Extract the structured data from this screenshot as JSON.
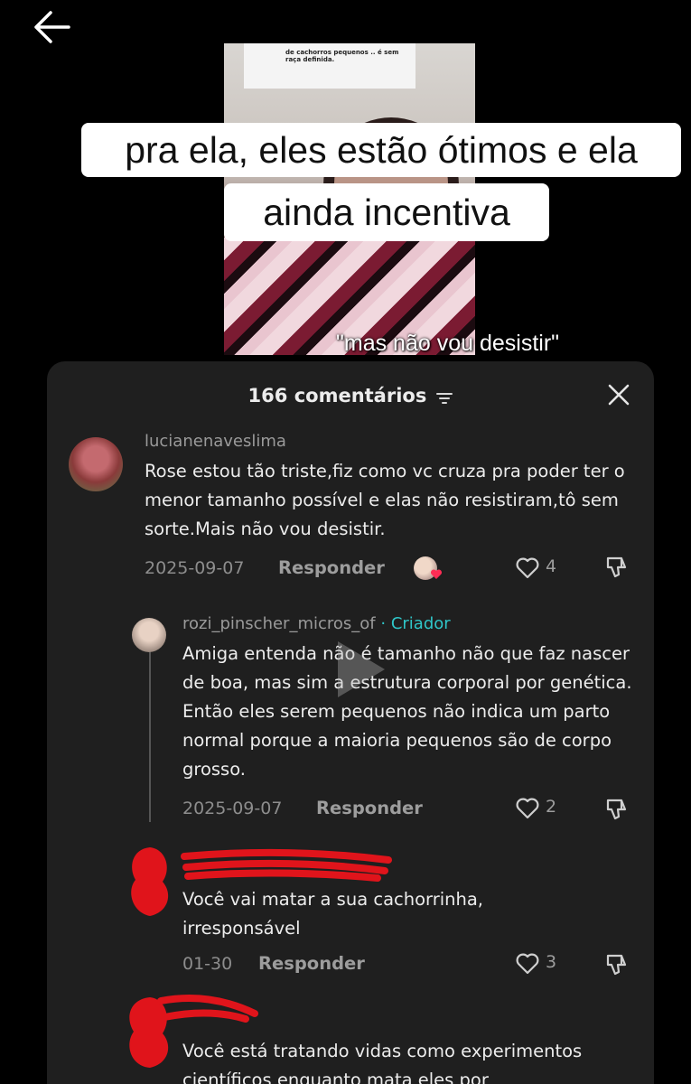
{
  "video": {
    "note_text": "de cachorros pequenos .. é sem raça definida.",
    "caption_line1": "pra ela, eles estão ótimos e ela",
    "caption_line2": "ainda incentiva",
    "subtitle": "\"mas não vou desistir\""
  },
  "comments_sheet": {
    "title": "166 comentários",
    "filter_icon": "filter-icon",
    "close_icon": "close-icon",
    "comments": [
      {
        "username": "lucianenaveslima",
        "text": "Rose estou tão triste,fiz como vc cruza pra poder ter o menor tamanho possível e elas não resistiram,tô sem sorte.Mais não vou desistir.",
        "date": "2025-09-07",
        "reply_label": "Responder",
        "likes": "4"
      },
      {
        "username": "rozi_pinscher_micros_of",
        "badge": "· Criador",
        "text": "Amiga entenda não é tamanho não que faz nascer de boa, mas sim a estrutura corporal por genética. Então eles serem pequenos não indica um parto normal porque a maioria pequenos são de corpo grosso.",
        "date": "2025-09-07",
        "reply_label": "Responder",
        "likes": "2"
      },
      {
        "username": "",
        "text": "Você vai matar a sua cachorrinha, irresponsável",
        "date": "01-30",
        "reply_label": "Responder",
        "likes": "3"
      },
      {
        "username": "",
        "text": "Você está tratando vidas como experimentos científicos enquanto mata eles por"
      }
    ]
  },
  "colors": {
    "background": "#000000",
    "sheet": "#1f1f1f",
    "creator_accent": "#2fc6c8",
    "redaction": "#e0141b"
  }
}
